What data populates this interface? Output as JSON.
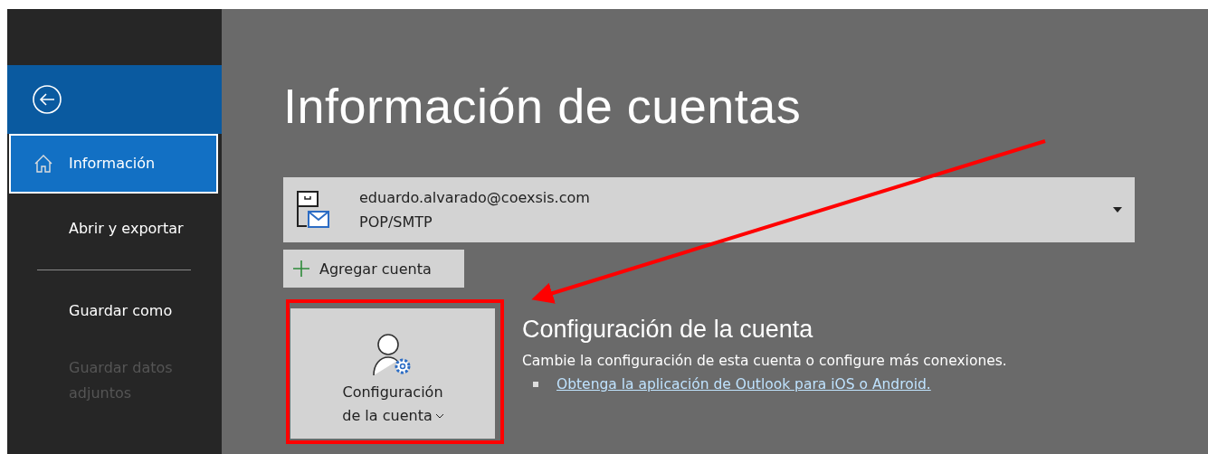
{
  "sidebar": {
    "items": [
      {
        "kind": "back"
      },
      {
        "kind": "home",
        "label": "Información",
        "selected": true,
        "disabled": false
      },
      {
        "kind": "item",
        "label": "Abrir y exportar",
        "selected": false,
        "disabled": false
      },
      {
        "kind": "separator"
      },
      {
        "kind": "item",
        "label": "Guardar como",
        "selected": false,
        "disabled": false
      },
      {
        "kind": "item",
        "label": "Guardar datos adjuntos",
        "selected": false,
        "disabled": true
      }
    ]
  },
  "main": {
    "title": "Información de cuentas",
    "account": {
      "email": "eduardo.alvarado@coexsis.com",
      "type": "POP/SMTP"
    },
    "add_button": "Agregar cuenta",
    "settings_button": {
      "line1": "Configuración",
      "line2": "de la cuenta"
    },
    "settings_section": {
      "heading": "Configuración de la cuenta",
      "description": "Cambie la configuración de esta cuenta o configure más conexiones.",
      "link": "Obtenga la aplicación de Outlook para iOS o Android."
    }
  }
}
